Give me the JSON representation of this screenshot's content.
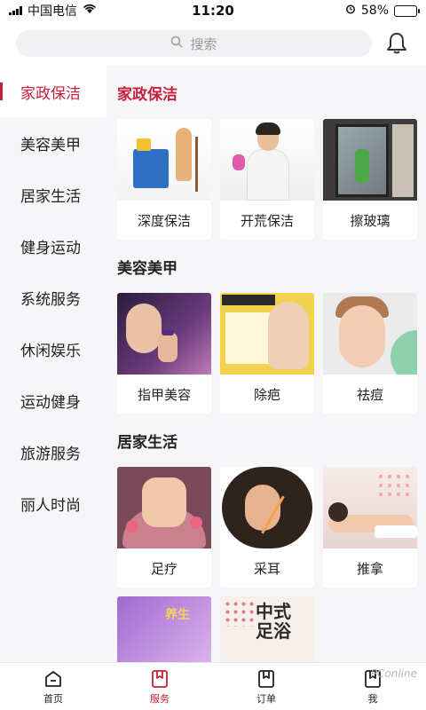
{
  "status": {
    "carrier": "中国电信",
    "time": "11:20",
    "battery": "58%",
    "battery_level": 0.58
  },
  "header": {
    "search_placeholder": "搜索",
    "search_icon": "search-icon",
    "bell_icon": "bell-icon"
  },
  "sidebar": {
    "items": [
      {
        "label": "家政保洁",
        "active": true
      },
      {
        "label": "美容美甲"
      },
      {
        "label": "居家生活"
      },
      {
        "label": "健身运动"
      },
      {
        "label": "系统服务"
      },
      {
        "label": "休闲娱乐"
      },
      {
        "label": "运动健身"
      },
      {
        "label": "旅游服务"
      },
      {
        "label": "丽人时尚"
      }
    ]
  },
  "sections": [
    {
      "title": "家政保洁",
      "items": [
        {
          "label": "深度保洁"
        },
        {
          "label": "开荒保洁"
        },
        {
          "label": "擦玻璃"
        }
      ]
    },
    {
      "title": "美容美甲",
      "items": [
        {
          "label": "指甲美容"
        },
        {
          "label": "除疤"
        },
        {
          "label": "祛痘"
        }
      ]
    },
    {
      "title": "居家生活",
      "items": [
        {
          "label": "足疗"
        },
        {
          "label": "采耳"
        },
        {
          "label": "推拿"
        }
      ]
    }
  ],
  "tabs": [
    {
      "label": "首页",
      "icon": "home-icon"
    },
    {
      "label": "服务",
      "icon": "service-icon",
      "active": true
    },
    {
      "label": "订单",
      "icon": "order-icon"
    },
    {
      "label": "我",
      "icon": "profile-icon"
    }
  ],
  "watermark": "PConline",
  "colors": {
    "accent": "#c5203b",
    "sidebar_bg": "#f6f6f8",
    "search_bg": "#f1f1f3"
  }
}
